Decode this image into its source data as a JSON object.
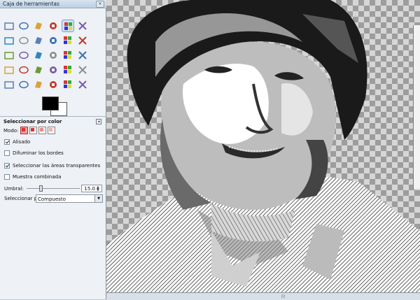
{
  "window": {
    "title": "Caja de herramientas",
    "close_label": "×"
  },
  "tools": [
    "rect-select",
    "ellipse-select",
    "free-select",
    "fuzzy-select",
    "select-by-color",
    "scissors-select",
    "paths",
    "color-picker",
    "zoom",
    "measure",
    "move",
    "align",
    "crop",
    "rotate",
    "scale",
    "shear",
    "perspective",
    "flip",
    "text",
    "blend",
    "pencil",
    "paintbrush",
    "eraser",
    "airbrush",
    "ink",
    "clone",
    "heal",
    "smudge",
    "dodge-burn",
    "bucket-fill"
  ],
  "colors": {
    "foreground": "#000000",
    "background": "#ffffff"
  },
  "options": {
    "title": "Seleccionar por color",
    "mode_label": "Modo:",
    "antialias": {
      "label": "Alisado",
      "checked": true
    },
    "feather": {
      "label": "Difuminar los bordes",
      "checked": false
    },
    "transparent": {
      "label": "Seleccionar las áreas transparentes",
      "checked": true
    },
    "merged": {
      "label": "Muestra combinada",
      "checked": false
    },
    "threshold": {
      "label": "Umbral:",
      "value": "15.0"
    },
    "select_by": {
      "label": "Seleccionar por:",
      "value": "Compuesto"
    }
  }
}
